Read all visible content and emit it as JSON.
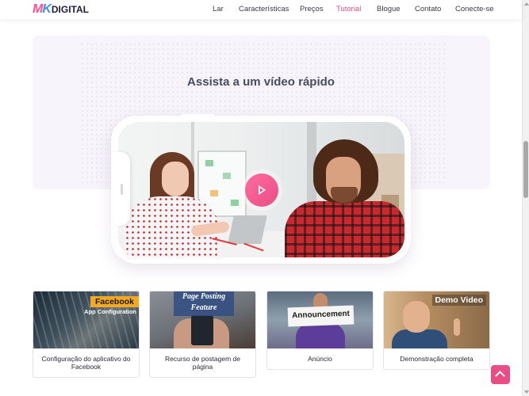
{
  "brand": {
    "logo_mk": "MK",
    "logo_text": "DIGITAL",
    "accent": "#e94d84",
    "logo_blue": "#3e8ef7"
  },
  "nav": {
    "items": [
      {
        "label": "Lar",
        "active": false
      },
      {
        "label": "Características",
        "active": false
      },
      {
        "label": "Preços",
        "active": false
      },
      {
        "label": "Tutorial",
        "active": true
      },
      {
        "label": "Blogue",
        "active": false
      },
      {
        "label": "Contato",
        "active": false
      },
      {
        "label": "Conecte-se",
        "active": false
      }
    ]
  },
  "video_section": {
    "title": "Assista a um vídeo rápido",
    "play_icon": "play-icon"
  },
  "cards": [
    {
      "image_tag": "Facebook",
      "image_subtag": "App Configuration",
      "caption": "Configuração do aplicativo do Facebook"
    },
    {
      "image_tag": "Page Posting",
      "image_subtag": "Feature",
      "caption": "Recurso de postagem de página"
    },
    {
      "image_tag": "Announcement",
      "caption": "Anúncio"
    },
    {
      "image_tag": "Demo Video",
      "caption": "Demonstração completa"
    }
  ],
  "back_to_top": {
    "icon": "chevron-up-icon"
  }
}
